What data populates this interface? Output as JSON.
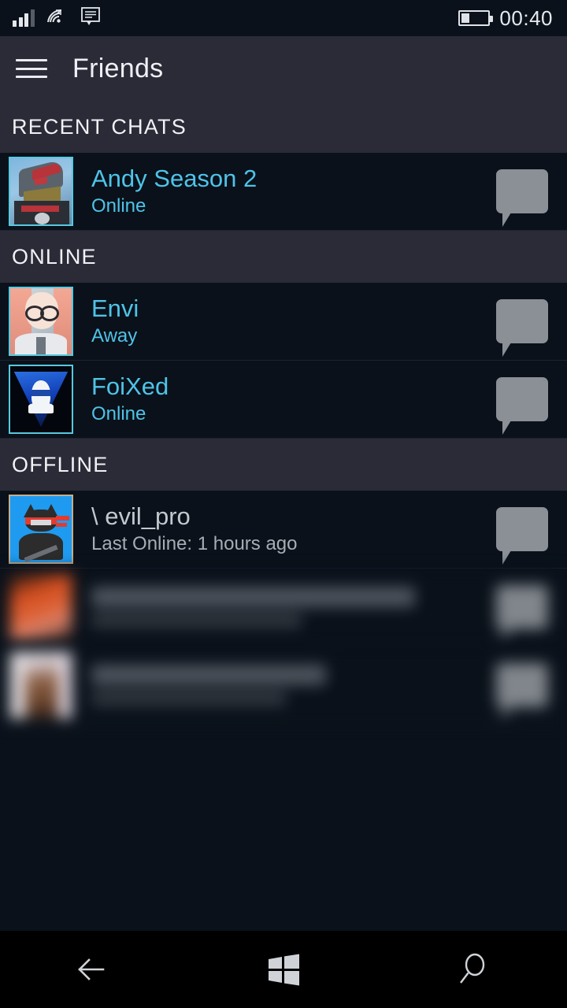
{
  "status_bar": {
    "signal_icon": "signal-bars-icon",
    "network_icon": "wifi-data-icon",
    "message_icon": "sms-icon",
    "battery_icon": "battery-icon",
    "battery_level_percent": 30,
    "time": "00:40"
  },
  "app_bar": {
    "menu_icon": "hamburger-menu-icon",
    "title": "Friends"
  },
  "colors": {
    "accent_cyan": "#4fc3e8",
    "app_bar_bg": "#2b2b38",
    "list_bg": "#0a111a",
    "section_header_bg": "#2b2b38",
    "offline_text": "#c3c8ce",
    "chat_bubble": "#8b9096"
  },
  "sections": [
    {
      "id": "recent-chats",
      "title": "RECENT CHATS",
      "rows": [
        {
          "name": "Andy Season 2",
          "status": "Online",
          "state": "online",
          "avatar": "mecha-avatar",
          "avatar_border": "#58c8e0",
          "action_icon": "chat-bubble-icon",
          "blurred": false
        }
      ]
    },
    {
      "id": "online",
      "title": "ONLINE",
      "rows": [
        {
          "name": "Envi",
          "status": "Away",
          "state": "online",
          "avatar": "anime-girl-avatar",
          "avatar_border": "#58c8e0",
          "action_icon": "chat-bubble-icon",
          "blurred": false
        },
        {
          "name": "FoiXed",
          "status": "Online",
          "state": "online",
          "avatar": "blue-triangle-logo-avatar",
          "avatar_border": "#58c8e0",
          "action_icon": "chat-bubble-icon",
          "blurred": false
        }
      ]
    },
    {
      "id": "offline",
      "title": "OFFLINE",
      "rows": [
        {
          "name": "\\ evil_pro",
          "status": "Last Online: 1 hours ago",
          "state": "offline",
          "avatar": "ninja-cat-avatar",
          "avatar_border": "#c3ae8f",
          "action_icon": "chat-bubble-icon",
          "blurred": false
        },
        {
          "name": "",
          "status": "",
          "state": "offline",
          "avatar": "censored-orange-avatar",
          "action_icon": "chat-bubble-icon",
          "blurred": true
        },
        {
          "name": "",
          "status": "",
          "state": "offline",
          "avatar": "censored-portrait-avatar",
          "action_icon": "chat-bubble-icon",
          "blurred": true
        }
      ]
    }
  ],
  "nav_bar": {
    "back_icon": "back-arrow-icon",
    "start_icon": "windows-start-icon",
    "search_icon": "search-icon"
  }
}
